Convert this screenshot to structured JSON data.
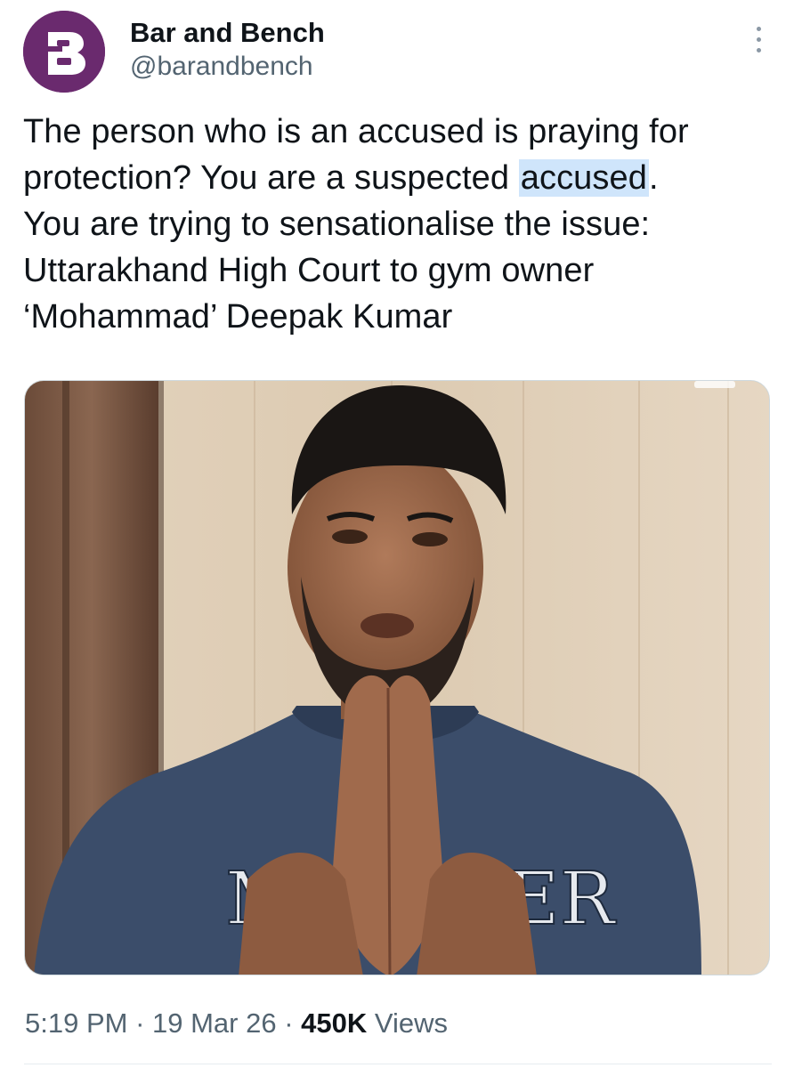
{
  "author": {
    "display_name": "Bar and Bench",
    "handle": "@barandbench",
    "avatar_letter": "B",
    "avatar_color": "#6a2a6e"
  },
  "tweet": {
    "line1": "The person who is an accused is praying for",
    "line2_before": "protection? You are a suspected ",
    "line2_highlight": "accused",
    "line2_after": ".",
    "line3": "You are trying to sensationalise the issue:",
    "line4": "Uttarakhand High Court to gym owner",
    "line5": "‘Mohammad’ Deepak Kumar",
    "highlight_color": "#cfe5fb"
  },
  "media": {
    "shirt_text_left": "MA",
    "shirt_text_right": "STER"
  },
  "meta": {
    "time": "5:19 PM",
    "separator": " · ",
    "date": "19 Mar 26",
    "views_count": "450K",
    "views_label": " Views"
  },
  "icons": {
    "more": "more-vertical-icon"
  }
}
